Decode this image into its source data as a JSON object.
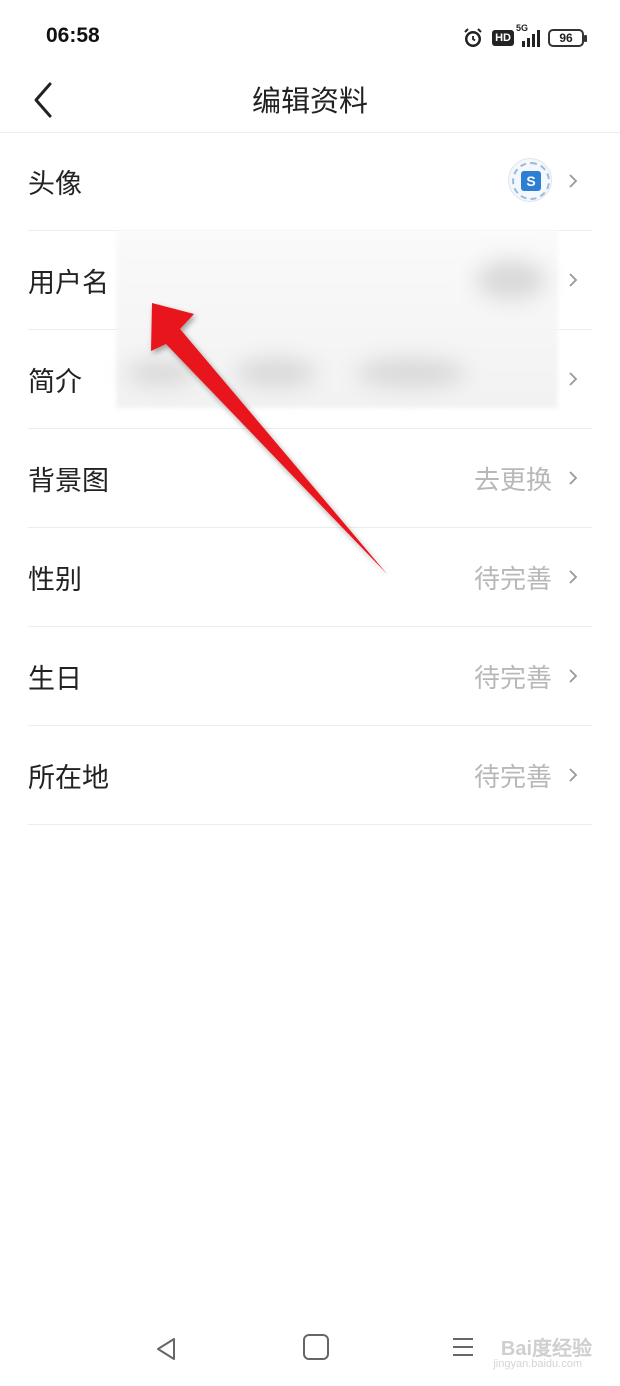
{
  "status_bar": {
    "time": "06:58",
    "hd": "HD",
    "network": "5G",
    "battery": "96"
  },
  "header": {
    "title": "编辑资料"
  },
  "rows": [
    {
      "label": "头像",
      "value": ""
    },
    {
      "label": "用户名",
      "value": ""
    },
    {
      "label": "简介",
      "value": ""
    },
    {
      "label": "背景图",
      "value": "去更换"
    },
    {
      "label": "性别",
      "value": "待完善"
    },
    {
      "label": "生日",
      "value": "待完善"
    },
    {
      "label": "所在地",
      "value": "待完善"
    }
  ],
  "watermark": {
    "main": "Bai度经验",
    "sub": "jingyan.baidu.com"
  },
  "colors": {
    "value_gray": "#b8b8b8",
    "divider": "#ececec",
    "arrow_red": "#e8141c"
  },
  "icons": [
    "alarm-icon",
    "back-icon",
    "chevron-right-icon",
    "nav-back-icon",
    "nav-home-icon",
    "nav-menu-icon"
  ]
}
